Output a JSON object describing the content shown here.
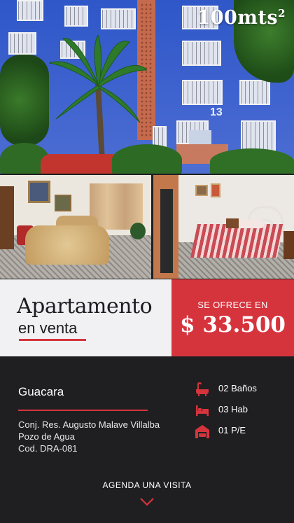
{
  "listing": {
    "area": "100mts",
    "area_unit_sup": "2",
    "title": "Apartamento",
    "subtitle": "en venta",
    "offer_label": "SE OFRECE EN",
    "price": "$ 33.500",
    "city": "Guacara",
    "address_lines": [
      "Conj. Res. Augusto Malave Villalba",
      "Pozo de Agua",
      "Cod. DRA-081"
    ],
    "building_number": "13"
  },
  "features": [
    {
      "label": "02 Baños",
      "icon": "bathtub-icon"
    },
    {
      "label": "03 Hab",
      "icon": "bed-icon"
    },
    {
      "label": "01 P/E",
      "icon": "car-garage-icon"
    }
  ],
  "cta": {
    "label": "AGENDA UNA VISITA",
    "icon": "chevron-down-icon"
  },
  "colors": {
    "accent": "#d6343d",
    "dark": "#1f1f21",
    "light": "#f1f1f4"
  }
}
